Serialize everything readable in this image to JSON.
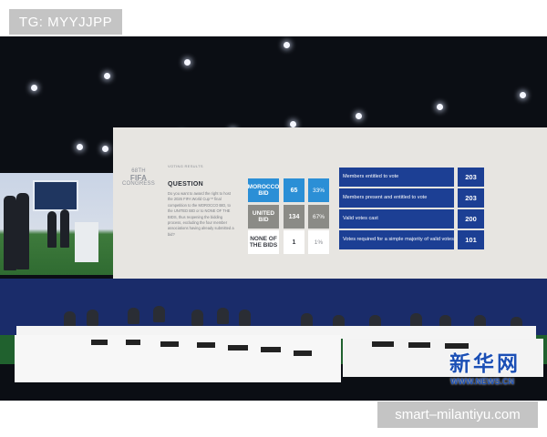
{
  "overlays": {
    "top_left_tag": "TG: MYYJJPP",
    "bottom_right_tag": "smart–milantiyu.com"
  },
  "watermark": {
    "chinese": "新华网",
    "url": "WWW.NEWS.CN",
    "color": "#1b4fb5"
  },
  "screen": {
    "logo": [
      "68TH",
      "FIFA",
      "CONGRESS"
    ],
    "section_label": "VOTING RESULTS",
    "question_title": "QUESTION",
    "question_text": [
      "Do you want to award the right to host",
      "the 2026 FIFA World Cup™ final",
      "competition to the MOROCCO BID, to",
      "the UNITED BID or to NONE OF THE",
      "BIDS, thus reopening the bidding",
      "process, excluding the four member",
      "associations having already submitted a",
      "bid?"
    ],
    "results": [
      {
        "label": "MOROCCO BID",
        "count": "65",
        "percent": "33%",
        "color": "#2b8fd6"
      },
      {
        "label": "UNITED BID",
        "count": "134",
        "percent": "67%",
        "color": "#8b8b86"
      },
      {
        "label": "NONE OF THE BIDS",
        "count": "1",
        "percent": "1%",
        "color": "#ffffff"
      }
    ],
    "stats": [
      {
        "label": "Members entitled to vote",
        "value": "203"
      },
      {
        "label": "Members present and entitled to vote",
        "value": "203"
      },
      {
        "label": "Valid votes cast",
        "value": "200"
      },
      {
        "label": "Votes required for a simple majority of valid votes",
        "value": "101"
      }
    ],
    "stat_color": "#1c3f94"
  },
  "colors": {
    "hall_background": "#0b0e14",
    "screen_background": "#e7e5e1",
    "wall": "#1a2c6a",
    "floor": "#20612e"
  }
}
